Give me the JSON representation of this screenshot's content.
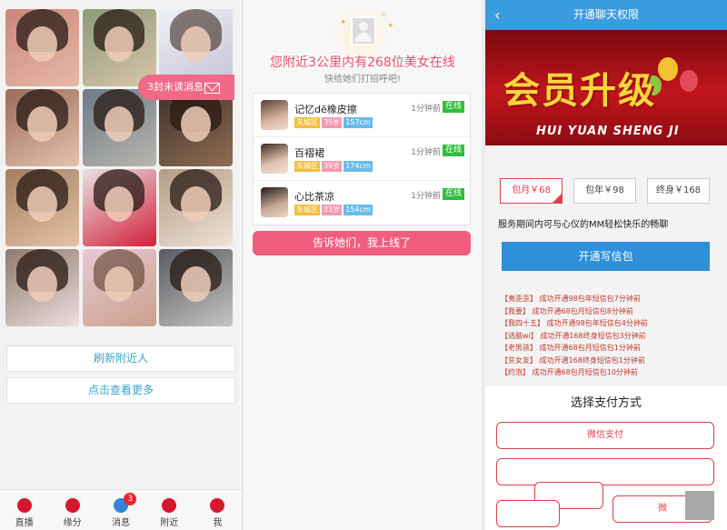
{
  "colors": {
    "accent_pink": "#ef5e7e",
    "accent_blue": "#2d90d9",
    "online_green": "#2fbf3c",
    "red": "#e0404a"
  },
  "panel1": {
    "photos": 12,
    "unread_label": "3封未读消息",
    "refresh_label": "刷新附近人",
    "more_label": "点击查看更多",
    "tabs": [
      {
        "label": "直播",
        "icon": "live-icon"
      },
      {
        "label": "缘分",
        "icon": "heart-icon"
      },
      {
        "label": "消息",
        "icon": "chat-icon",
        "badge": "3"
      },
      {
        "label": "附近",
        "icon": "location-icon"
      },
      {
        "label": "我",
        "icon": "home-icon"
      }
    ]
  },
  "panel2": {
    "headline": "您附近3公里内有268位美女在线",
    "subline": "快给她们打招呼吧!",
    "users": [
      {
        "name": "记忆dē橡皮擦",
        "district": "东城区",
        "age": "35岁",
        "height": "157cm",
        "time": "1分钟前",
        "status": "在线"
      },
      {
        "name": "百褶裙",
        "district": "东城区",
        "age": "39岁",
        "height": "174cm",
        "time": "1分钟前",
        "status": "在线"
      },
      {
        "name": "心比茶凉",
        "district": "东城区",
        "age": "33岁",
        "height": "154cm",
        "time": "1分钟前",
        "status": "在线"
      }
    ],
    "tell_label": "告诉她们，我上线了"
  },
  "panel3": {
    "title": "开通聊天权限",
    "banner_text": "会员升级",
    "banner_pinyin": "HUI YUAN SHENG JI",
    "plans": [
      "包月￥68",
      "包年￥98",
      "终身￥168"
    ],
    "description": "服务期间内可与心仪的MM轻松快乐的畅聊",
    "open_label": "开通写信包",
    "log": [
      {
        "nick": "【夷歪歪】",
        "text": "成功开通98包年短信包7分钟前"
      },
      {
        "nick": "【我要】",
        "text": "成功开通68包月短信包8分钟前"
      },
      {
        "nick": "【我四十五】",
        "text": "成功开通98包年短信包4分钟前"
      },
      {
        "nick": "【逃脑wi】",
        "text": "成功开通168终身短信包3分钟前"
      },
      {
        "nick": "【老男孩】",
        "text": "成功开通68包月短信包1分钟前"
      },
      {
        "nick": "【贫女友】",
        "text": "成功开通168终身短信包1分钟前"
      },
      {
        "nick": "【约泡】",
        "text": "成功开通68包月短信包10分钟前"
      }
    ],
    "pay_title": "选择支付方式",
    "pay_wechat": "微信支付",
    "pay_partial": "微"
  }
}
